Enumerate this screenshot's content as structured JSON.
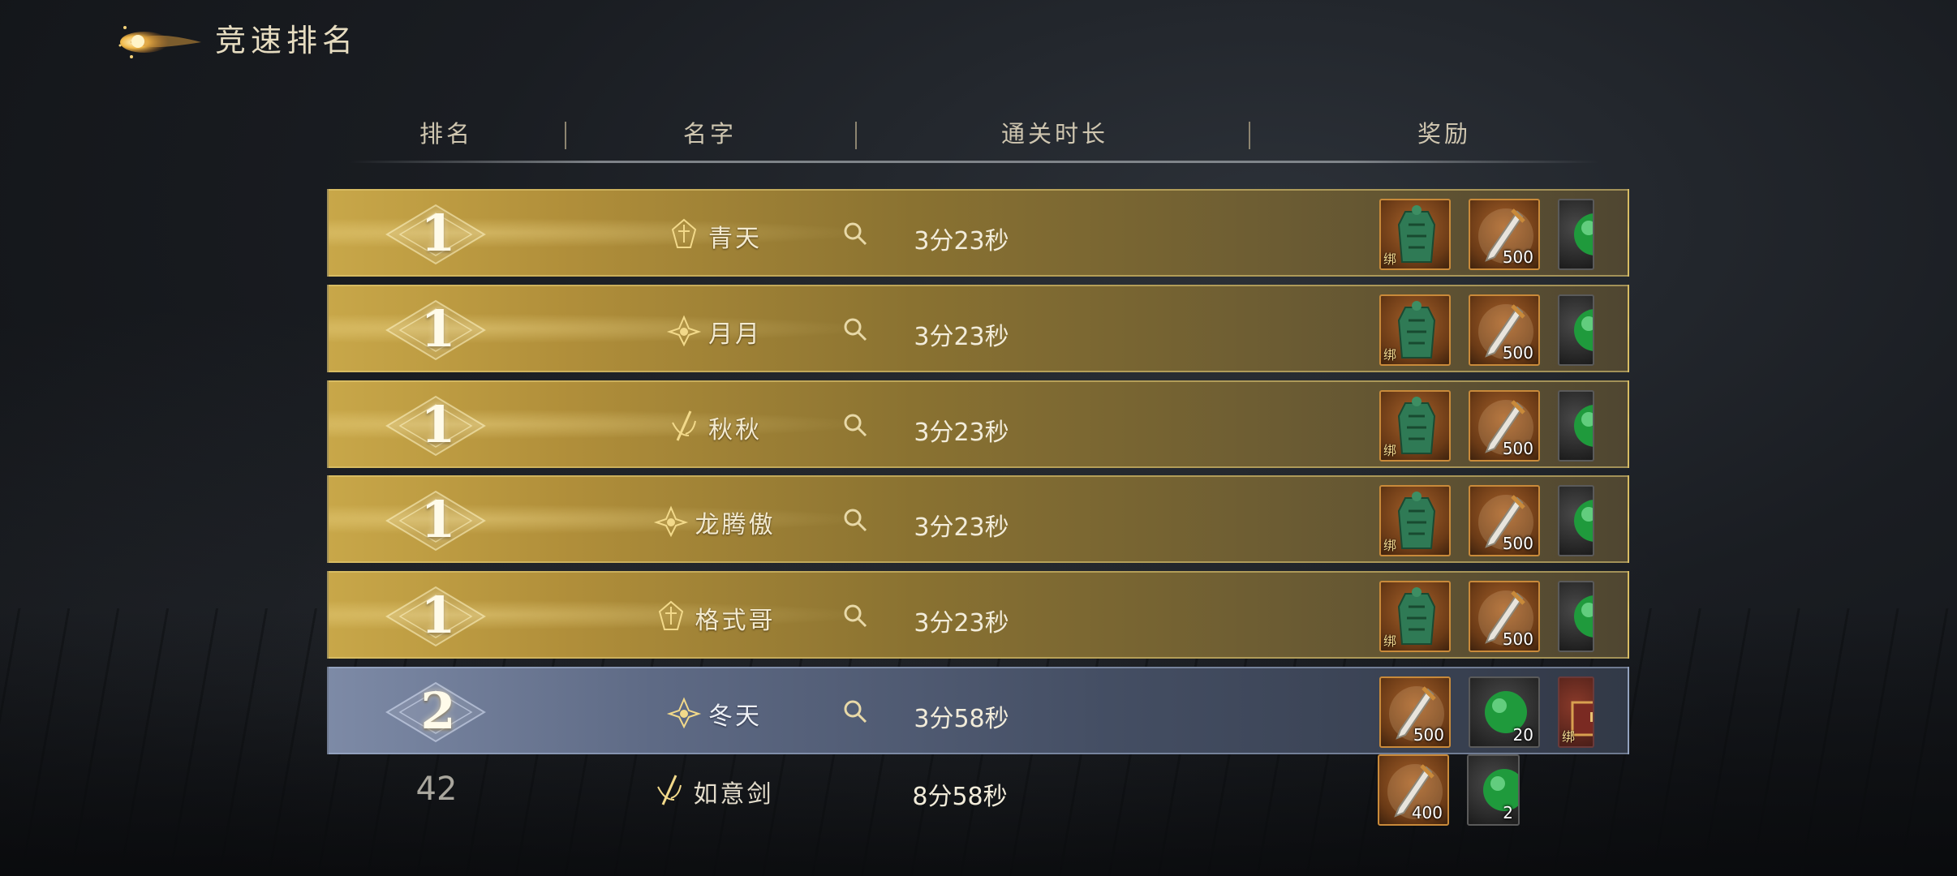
{
  "header": {
    "title": "竞速排名",
    "columns": [
      "排名",
      "名字",
      "通关时长",
      "奖励"
    ]
  },
  "rows": [
    {
      "rank": "1",
      "name": "青天",
      "time": "3分23秒",
      "style": "gold",
      "badge": "crest-icon",
      "rewards": [
        {
          "icon": "jade-token-icon",
          "qty": "",
          "tag": "绑"
        },
        {
          "icon": "sword-icon",
          "qty": "500",
          "tag": ""
        },
        {
          "icon": "jade-orb-icon",
          "qty": "",
          "tag": ""
        }
      ]
    },
    {
      "rank": "1",
      "name": "月月",
      "time": "3分23秒",
      "style": "gold",
      "badge": "lotus-icon",
      "rewards": [
        {
          "icon": "jade-token-icon",
          "qty": "",
          "tag": "绑"
        },
        {
          "icon": "sword-icon",
          "qty": "500",
          "tag": ""
        },
        {
          "icon": "jade-orb-icon",
          "qty": "",
          "tag": ""
        }
      ]
    },
    {
      "rank": "1",
      "name": "秋秋",
      "time": "3分23秒",
      "style": "gold",
      "badge": "sword-crest-icon",
      "rewards": [
        {
          "icon": "jade-token-icon",
          "qty": "",
          "tag": "绑"
        },
        {
          "icon": "sword-icon",
          "qty": "500",
          "tag": ""
        },
        {
          "icon": "jade-orb-icon",
          "qty": "",
          "tag": ""
        }
      ]
    },
    {
      "rank": "1",
      "name": "龙腾傲",
      "time": "3分23秒",
      "style": "gold",
      "badge": "lotus-icon",
      "rewards": [
        {
          "icon": "jade-token-icon",
          "qty": "",
          "tag": "绑"
        },
        {
          "icon": "sword-icon",
          "qty": "500",
          "tag": ""
        },
        {
          "icon": "jade-orb-icon",
          "qty": "",
          "tag": ""
        }
      ]
    },
    {
      "rank": "1",
      "name": "格式哥",
      "time": "3分23秒",
      "style": "gold",
      "badge": "crest-icon",
      "rewards": [
        {
          "icon": "jade-token-icon",
          "qty": "",
          "tag": "绑"
        },
        {
          "icon": "sword-icon",
          "qty": "500",
          "tag": ""
        },
        {
          "icon": "jade-orb-icon",
          "qty": "",
          "tag": ""
        }
      ]
    },
    {
      "rank": "2",
      "name": "冬天",
      "time": "3分58秒",
      "style": "silver",
      "badge": "lotus-icon",
      "rewards": [
        {
          "icon": "sword-icon",
          "qty": "500",
          "tag": ""
        },
        {
          "icon": "jade-orb-icon",
          "qty": "20",
          "tag": ""
        },
        {
          "icon": "treasure-chest-icon",
          "qty": "",
          "tag": "绑"
        }
      ]
    },
    {
      "rank": "42",
      "name": "如意剑",
      "time": "8分58秒",
      "style": "plain",
      "badge": "sword-crest-icon",
      "rewards": [
        {
          "icon": "sword-icon",
          "qty": "400",
          "tag": ""
        },
        {
          "icon": "jade-orb-icon",
          "qty": "2",
          "tag": ""
        }
      ]
    }
  ],
  "colors": {
    "gold": "#c8a749",
    "silver": "#7d8aa6",
    "accent": "#e6dcc0"
  }
}
